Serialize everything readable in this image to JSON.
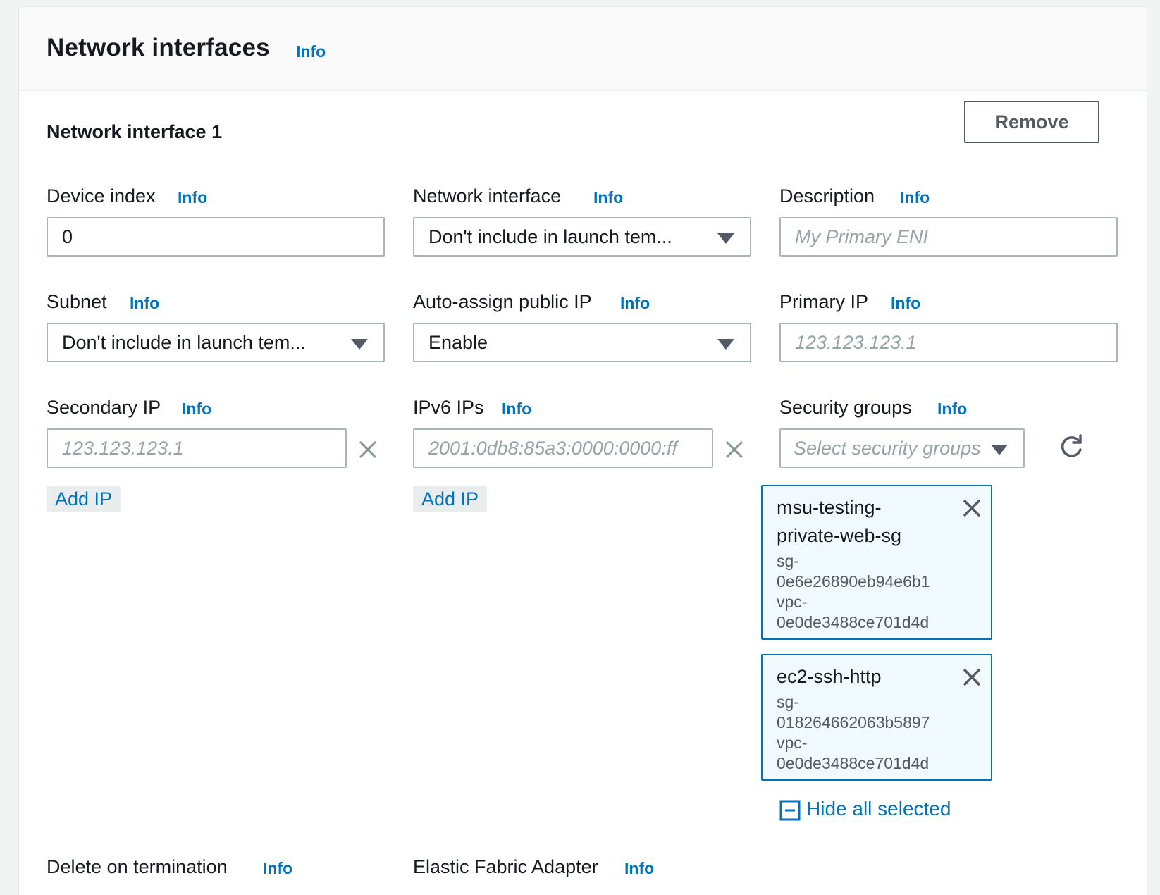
{
  "section": {
    "title": "Network interfaces",
    "info": "Info"
  },
  "interface": {
    "title": "Network interface 1",
    "remove_label": "Remove"
  },
  "fields": {
    "device_index": {
      "label": "Device index",
      "info": "Info",
      "value": "0"
    },
    "network_interface": {
      "label": "Network interface",
      "info": "Info",
      "value": "Don't include in launch tem..."
    },
    "description": {
      "label": "Description",
      "info": "Info",
      "placeholder": "My Primary ENI"
    },
    "subnet": {
      "label": "Subnet",
      "info": "Info",
      "value": "Don't include in launch tem..."
    },
    "auto_assign_ip": {
      "label": "Auto-assign public IP",
      "info": "Info",
      "value": "Enable"
    },
    "primary_ip": {
      "label": "Primary IP",
      "info": "Info",
      "placeholder": "123.123.123.1"
    },
    "secondary_ip": {
      "label": "Secondary IP",
      "info": "Info",
      "placeholder": "123.123.123.1",
      "add_label": "Add IP"
    },
    "ipv6_ips": {
      "label": "IPv6 IPs",
      "info": "Info",
      "placeholder": "2001:0db8:85a3:0000:0000:ff",
      "add_label": "Add IP"
    },
    "security_groups": {
      "label": "Security groups",
      "info": "Info",
      "placeholder": "Select security groups",
      "selected": [
        {
          "name_line1": "msu-testing-",
          "name_line2": "private-web-sg",
          "sg_prefix": "sg-",
          "sg_id": "0e6e26890eb94e6b1",
          "vpc_prefix": "vpc-",
          "vpc_id": "0e0de3488ce701d4d"
        },
        {
          "name_line1": "ec2-ssh-http",
          "sg_prefix": "sg-",
          "sg_id": "018264662063b5897",
          "vpc_prefix": "vpc-",
          "vpc_id": "0e0de3488ce701d4d"
        }
      ],
      "hide_label": "Hide all selected"
    },
    "delete_on_termination": {
      "label": "Delete on termination",
      "info": "Info"
    },
    "efa": {
      "label": "Elastic Fabric Adapter",
      "info": "Info"
    }
  },
  "colors": {
    "link": "#0073bb",
    "token_border": "#0073bb",
    "token_bg": "#f1faff",
    "input_border": "#aab7b8"
  },
  "icons": [
    "close-icon",
    "caret-down-icon",
    "refresh-icon",
    "collapse-square-icon"
  ]
}
